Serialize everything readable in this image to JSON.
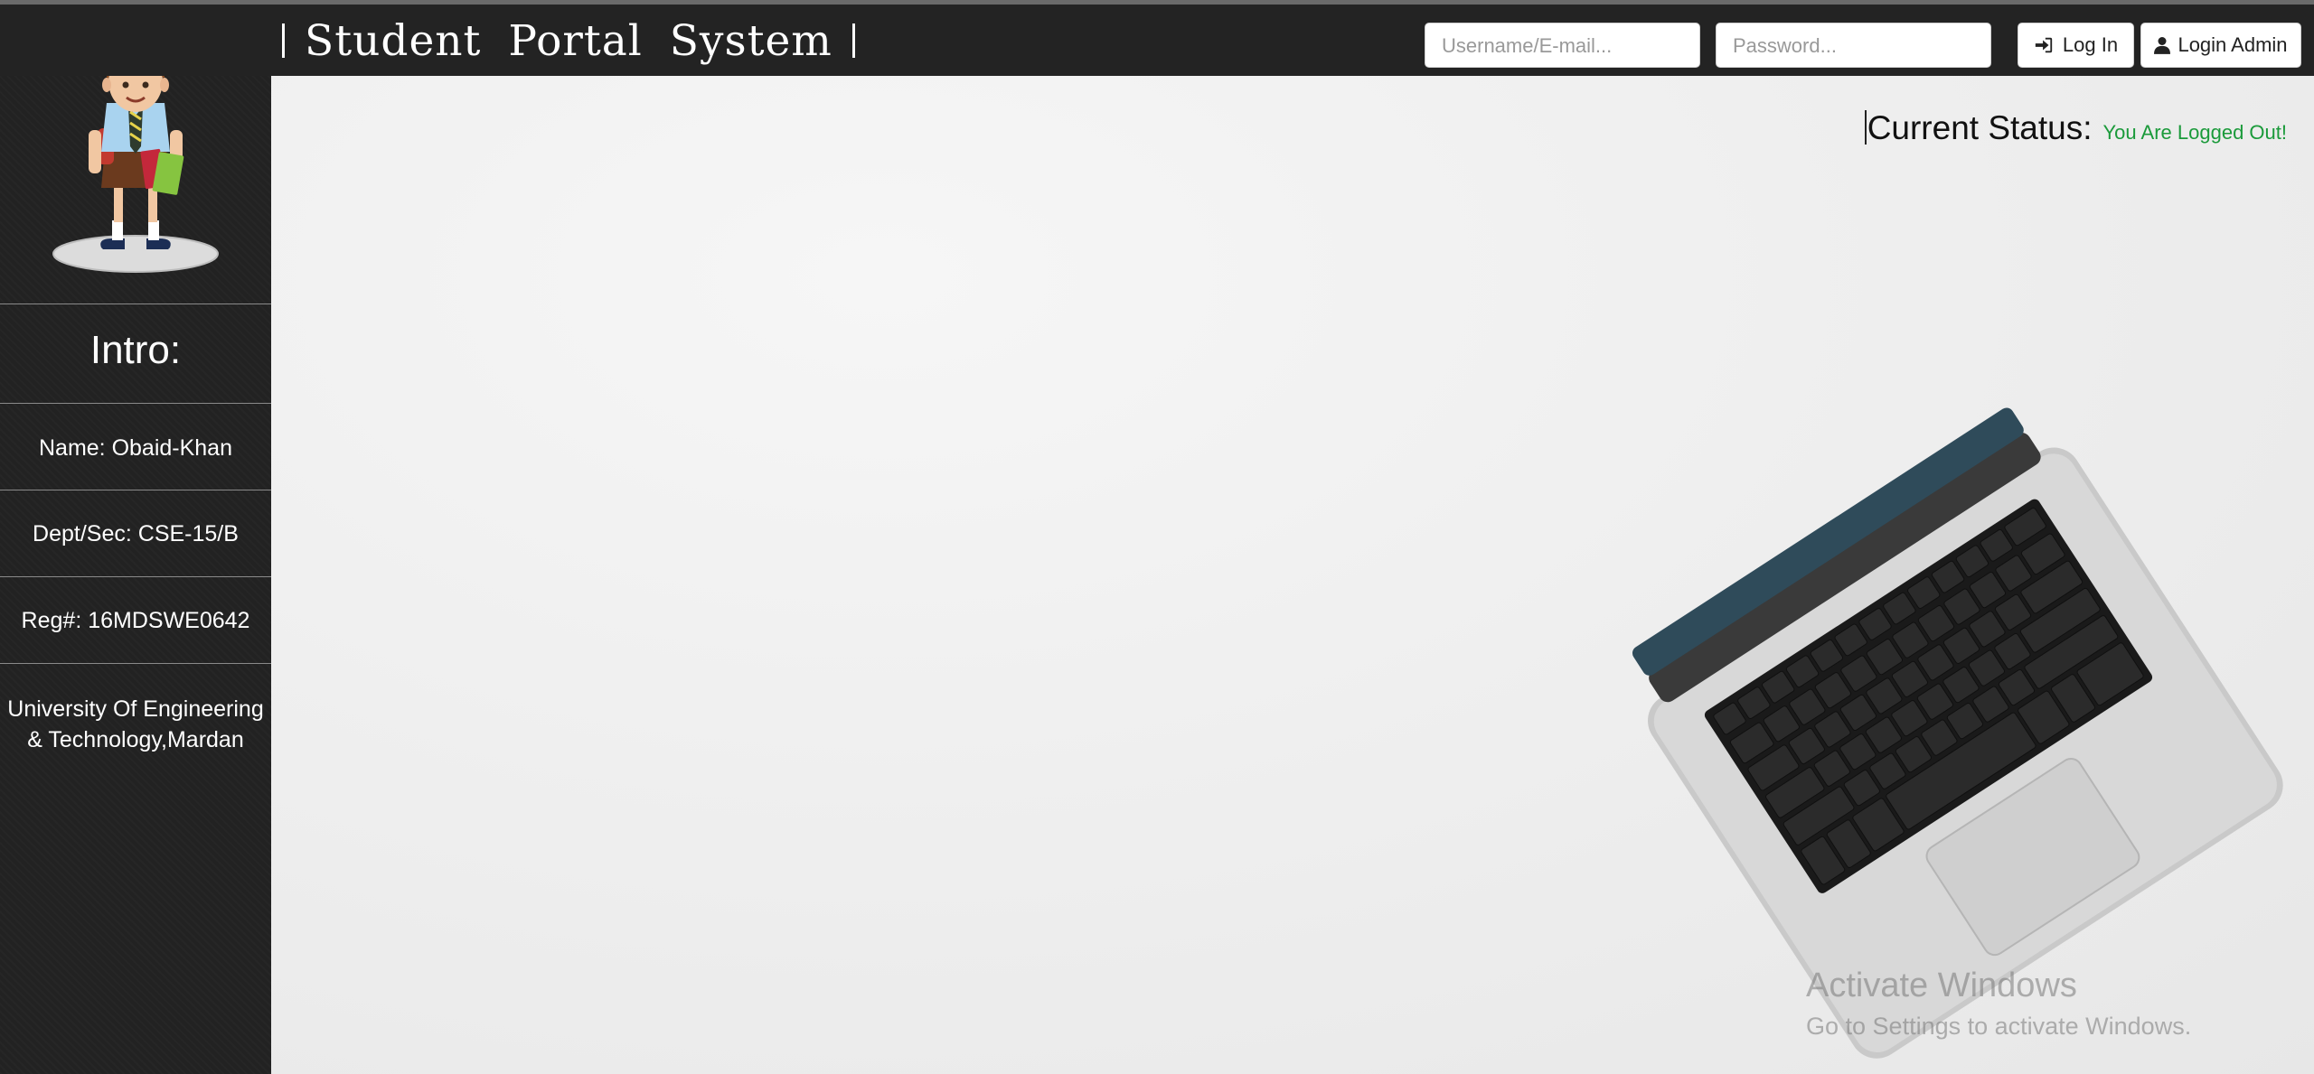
{
  "header": {
    "title": "Student Portal System",
    "username_placeholder": "Username/E-mail...",
    "password_placeholder": "Password...",
    "login_label": "Log In",
    "admin_label": "Login Admin"
  },
  "sidebar": {
    "intro": "Intro:",
    "name": "Name: Obaid-Khan",
    "dept": "Dept/Sec: CSE-15/B",
    "reg": "Reg#: 16MDSWE0642",
    "university": "University Of Engineering & Technology,Mardan"
  },
  "status": {
    "label": "Current Status:",
    "value": "You Are Logged Out!"
  },
  "watermark": {
    "line1": "Activate Windows",
    "line2": "Go to Settings to activate Windows."
  },
  "colors": {
    "navbar": "#232323",
    "sidebar": "#222222",
    "status_value": "#1a9a3a"
  },
  "icons": {
    "login": "sign-in-icon",
    "admin": "user-icon"
  }
}
